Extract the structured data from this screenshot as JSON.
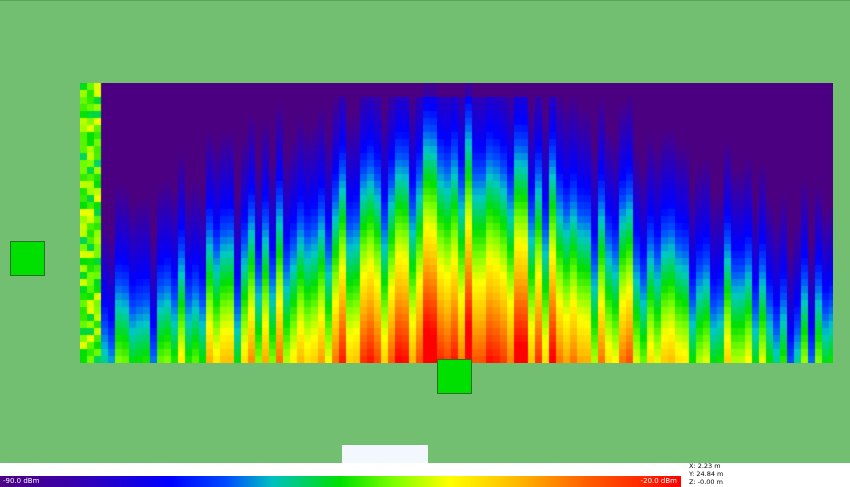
{
  "legend": {
    "min_label": "-90.0 dBm",
    "max_label": "-20.0 dBm"
  },
  "coords": {
    "x": "X: 2.23 m",
    "y": "Y: 24.84 m",
    "z": "Z: -0.00 m"
  },
  "colors": {
    "background": "#72bf72",
    "access_point": "#00e000"
  },
  "icons": {
    "access_point": "access-point-icon"
  }
}
